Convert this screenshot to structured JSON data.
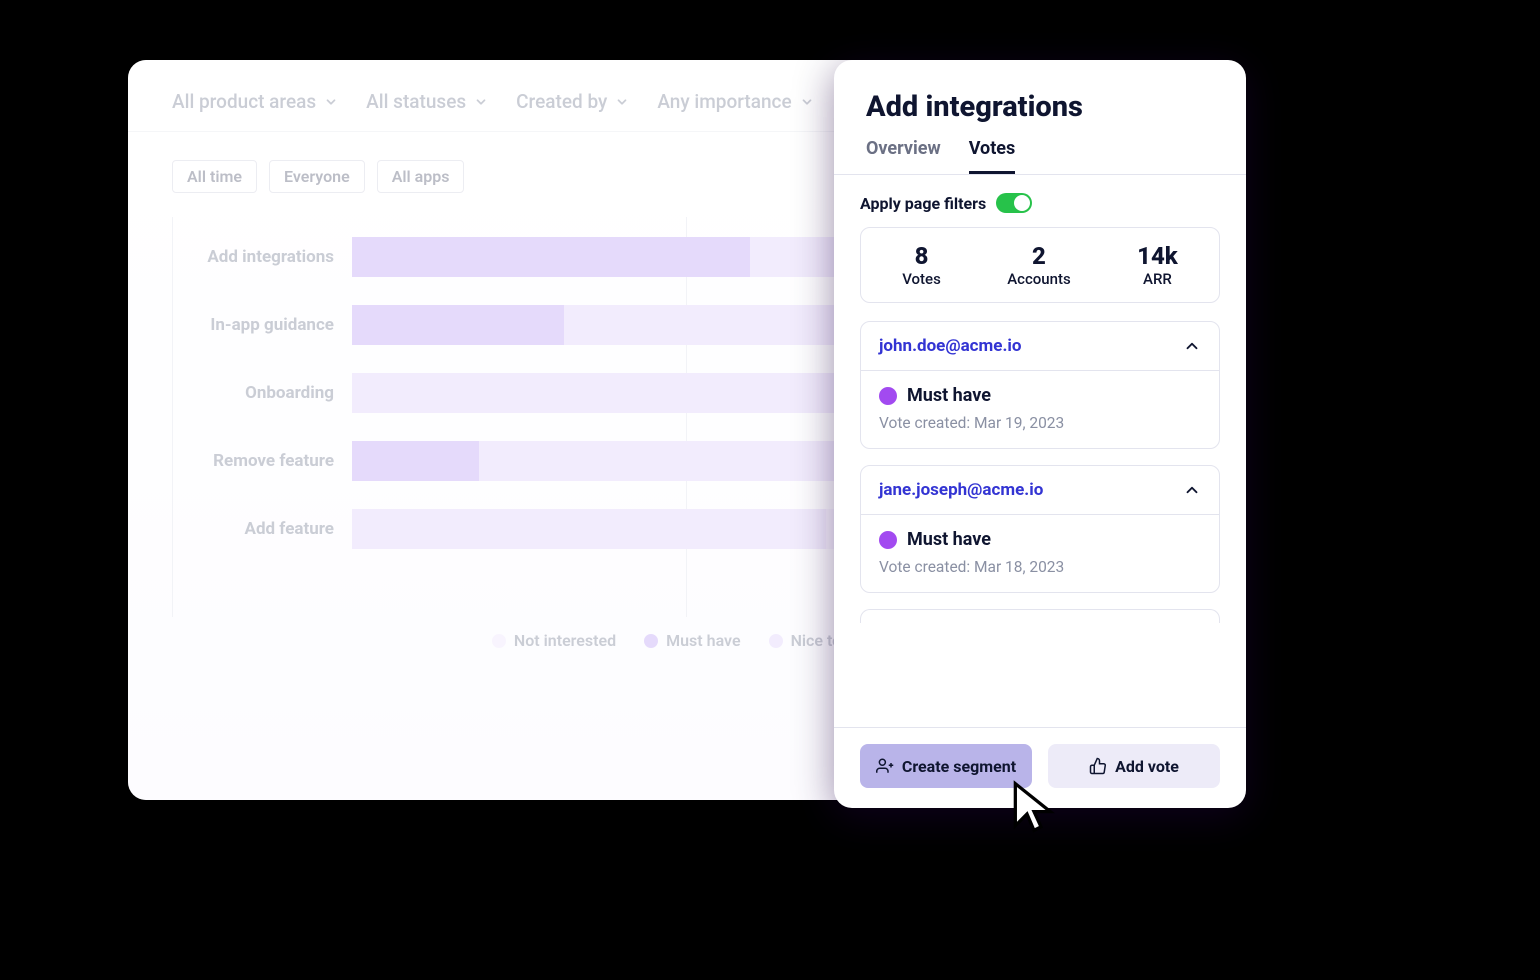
{
  "filter_bar": {
    "items": [
      {
        "label": "All product areas"
      },
      {
        "label": "All statuses"
      },
      {
        "label": "Created by"
      },
      {
        "label": "Any importance"
      }
    ]
  },
  "chips": [
    {
      "label": "All time"
    },
    {
      "label": "Everyone"
    },
    {
      "label": "All apps"
    }
  ],
  "legend": {
    "not_interested": "Not interested",
    "must_have": "Must have",
    "nice_to_have": "Nice to have"
  },
  "chart_data": {
    "type": "bar",
    "orientation": "horizontal",
    "stacked": true,
    "xlim": [
      0,
      100
    ],
    "series_names": [
      "Must have",
      "Nice to have",
      "Not interested"
    ],
    "categories": [
      "Add integrations",
      "In-app guidance",
      "Onboarding",
      "Remove feature",
      "Add feature"
    ],
    "series": [
      {
        "name": "Must have",
        "values": [
          47,
          25,
          0,
          15,
          0
        ]
      },
      {
        "name": "Nice to have",
        "values": [
          53,
          36,
          62,
          47,
          56
        ]
      },
      {
        "name": "Not interested",
        "values": [
          0,
          4,
          0,
          0,
          6
        ]
      }
    ]
  },
  "panel": {
    "title": "Add integrations",
    "tabs": {
      "overview": "Overview",
      "votes": "Votes"
    },
    "active_tab": "Votes",
    "apply_filters_label": "Apply page filters",
    "apply_filters_on": true,
    "stats": {
      "votes": {
        "n": "8",
        "l": "Votes"
      },
      "accounts": {
        "n": "2",
        "l": "Accounts"
      },
      "arr": {
        "n": "14k",
        "l": "ARR"
      }
    },
    "vote_cards": [
      {
        "email": "john.doe@acme.io",
        "importance": "Must have",
        "meta": "Vote created: Mar 19, 2023"
      },
      {
        "email": "jane.joseph@acme.io",
        "importance": "Must have",
        "meta": "Vote created: Mar 18, 2023"
      }
    ],
    "footer": {
      "create_segment": "Create segment",
      "add_vote": "Add vote"
    }
  }
}
